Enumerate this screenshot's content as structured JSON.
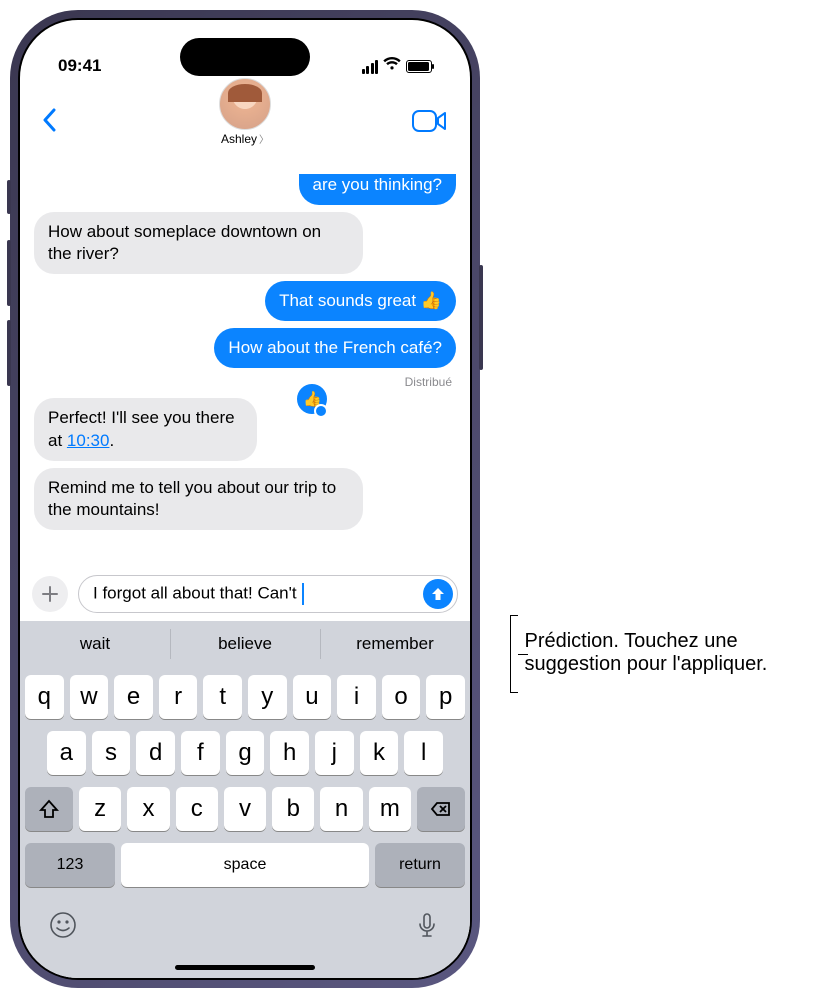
{
  "status": {
    "time": "09:41"
  },
  "nav": {
    "contact_name": "Ashley"
  },
  "messages": {
    "m0": "are you thinking?",
    "m1": "How about someplace downtown on the river?",
    "m2": "That sounds great 👍",
    "m3": "How about the French café?",
    "m3_status": "Distribué",
    "m4_pre": "Perfect! I'll see you there at ",
    "m4_time": "10:30",
    "m4_post": ".",
    "m5": "Remind me to tell you about our trip to the mountains!"
  },
  "compose": {
    "text": "I forgot all about that! Can't "
  },
  "predictions": {
    "p1": "wait",
    "p2": "believe",
    "p3": "remember"
  },
  "keyboard": {
    "row1": [
      "q",
      "w",
      "e",
      "r",
      "t",
      "y",
      "u",
      "i",
      "o",
      "p"
    ],
    "row2": [
      "a",
      "s",
      "d",
      "f",
      "g",
      "h",
      "j",
      "k",
      "l"
    ],
    "row3": [
      "z",
      "x",
      "c",
      "v",
      "b",
      "n",
      "m"
    ],
    "k123": "123",
    "space": "space",
    "return": "return"
  },
  "callout": {
    "text": "Prédiction. Touchez une suggestion pour l'appliquer."
  }
}
